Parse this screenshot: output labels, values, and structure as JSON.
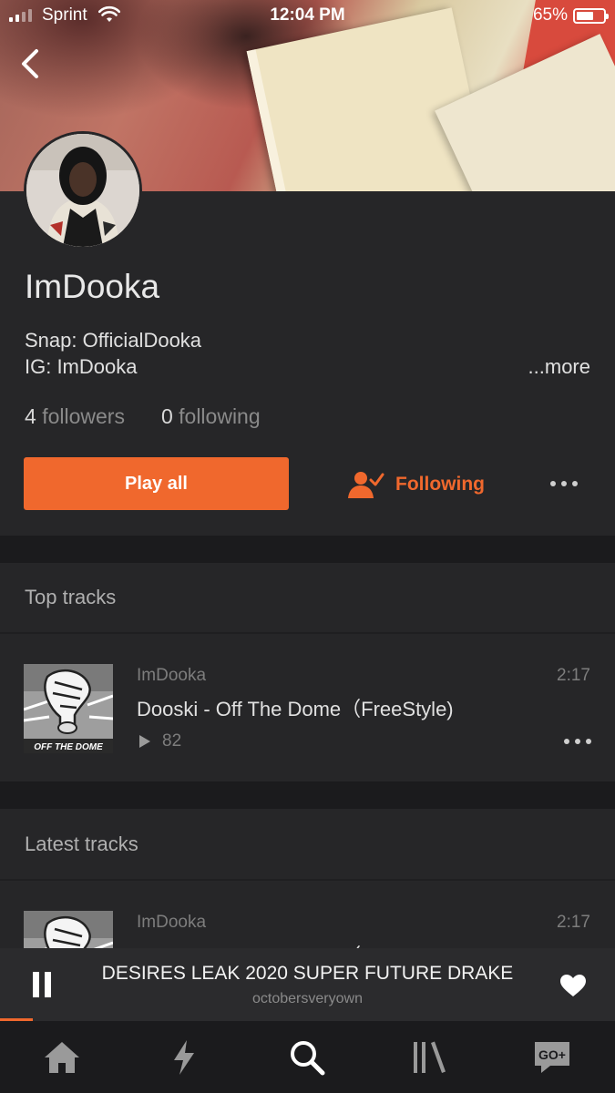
{
  "status_bar": {
    "carrier": "Sprint",
    "time": "12:04 PM",
    "battery": "65%",
    "battery_level": 0.65
  },
  "profile": {
    "username": "ImDooka",
    "bio_line1": "Snap: OfficialDooka",
    "bio_line2": "IG: ImDooka",
    "more_label": "...more",
    "followers_count": "4",
    "followers_label": "followers",
    "following_count": "0",
    "following_label": "following"
  },
  "actions": {
    "play_all": "Play all",
    "following": "Following"
  },
  "top_tracks": {
    "heading": "Top tracks",
    "items": [
      {
        "artist": "ImDooka",
        "title": "Dooski - Off The Dome（FreeStyle)",
        "duration": "2:17",
        "plays": "82",
        "cover_text": "OFF THE DOME"
      }
    ]
  },
  "latest_tracks": {
    "heading": "Latest tracks",
    "items": [
      {
        "artist": "ImDooka",
        "title": "Dooski - Off The Dome（FreeStyle)",
        "duration": "2:17"
      }
    ]
  },
  "now_playing": {
    "title": "DESIRES LEAK 2020 SUPER FUTURE DRAKE",
    "artist": "octobersveryown"
  },
  "tabs": [
    {
      "icon": "home-icon"
    },
    {
      "icon": "lightning-icon"
    },
    {
      "icon": "search-icon"
    },
    {
      "icon": "library-icon"
    },
    {
      "icon": "go-plus-icon",
      "label": "GO+"
    }
  ],
  "colors": {
    "accent": "#f0682d",
    "background": "#1b1b1d",
    "panel": "#262628"
  }
}
